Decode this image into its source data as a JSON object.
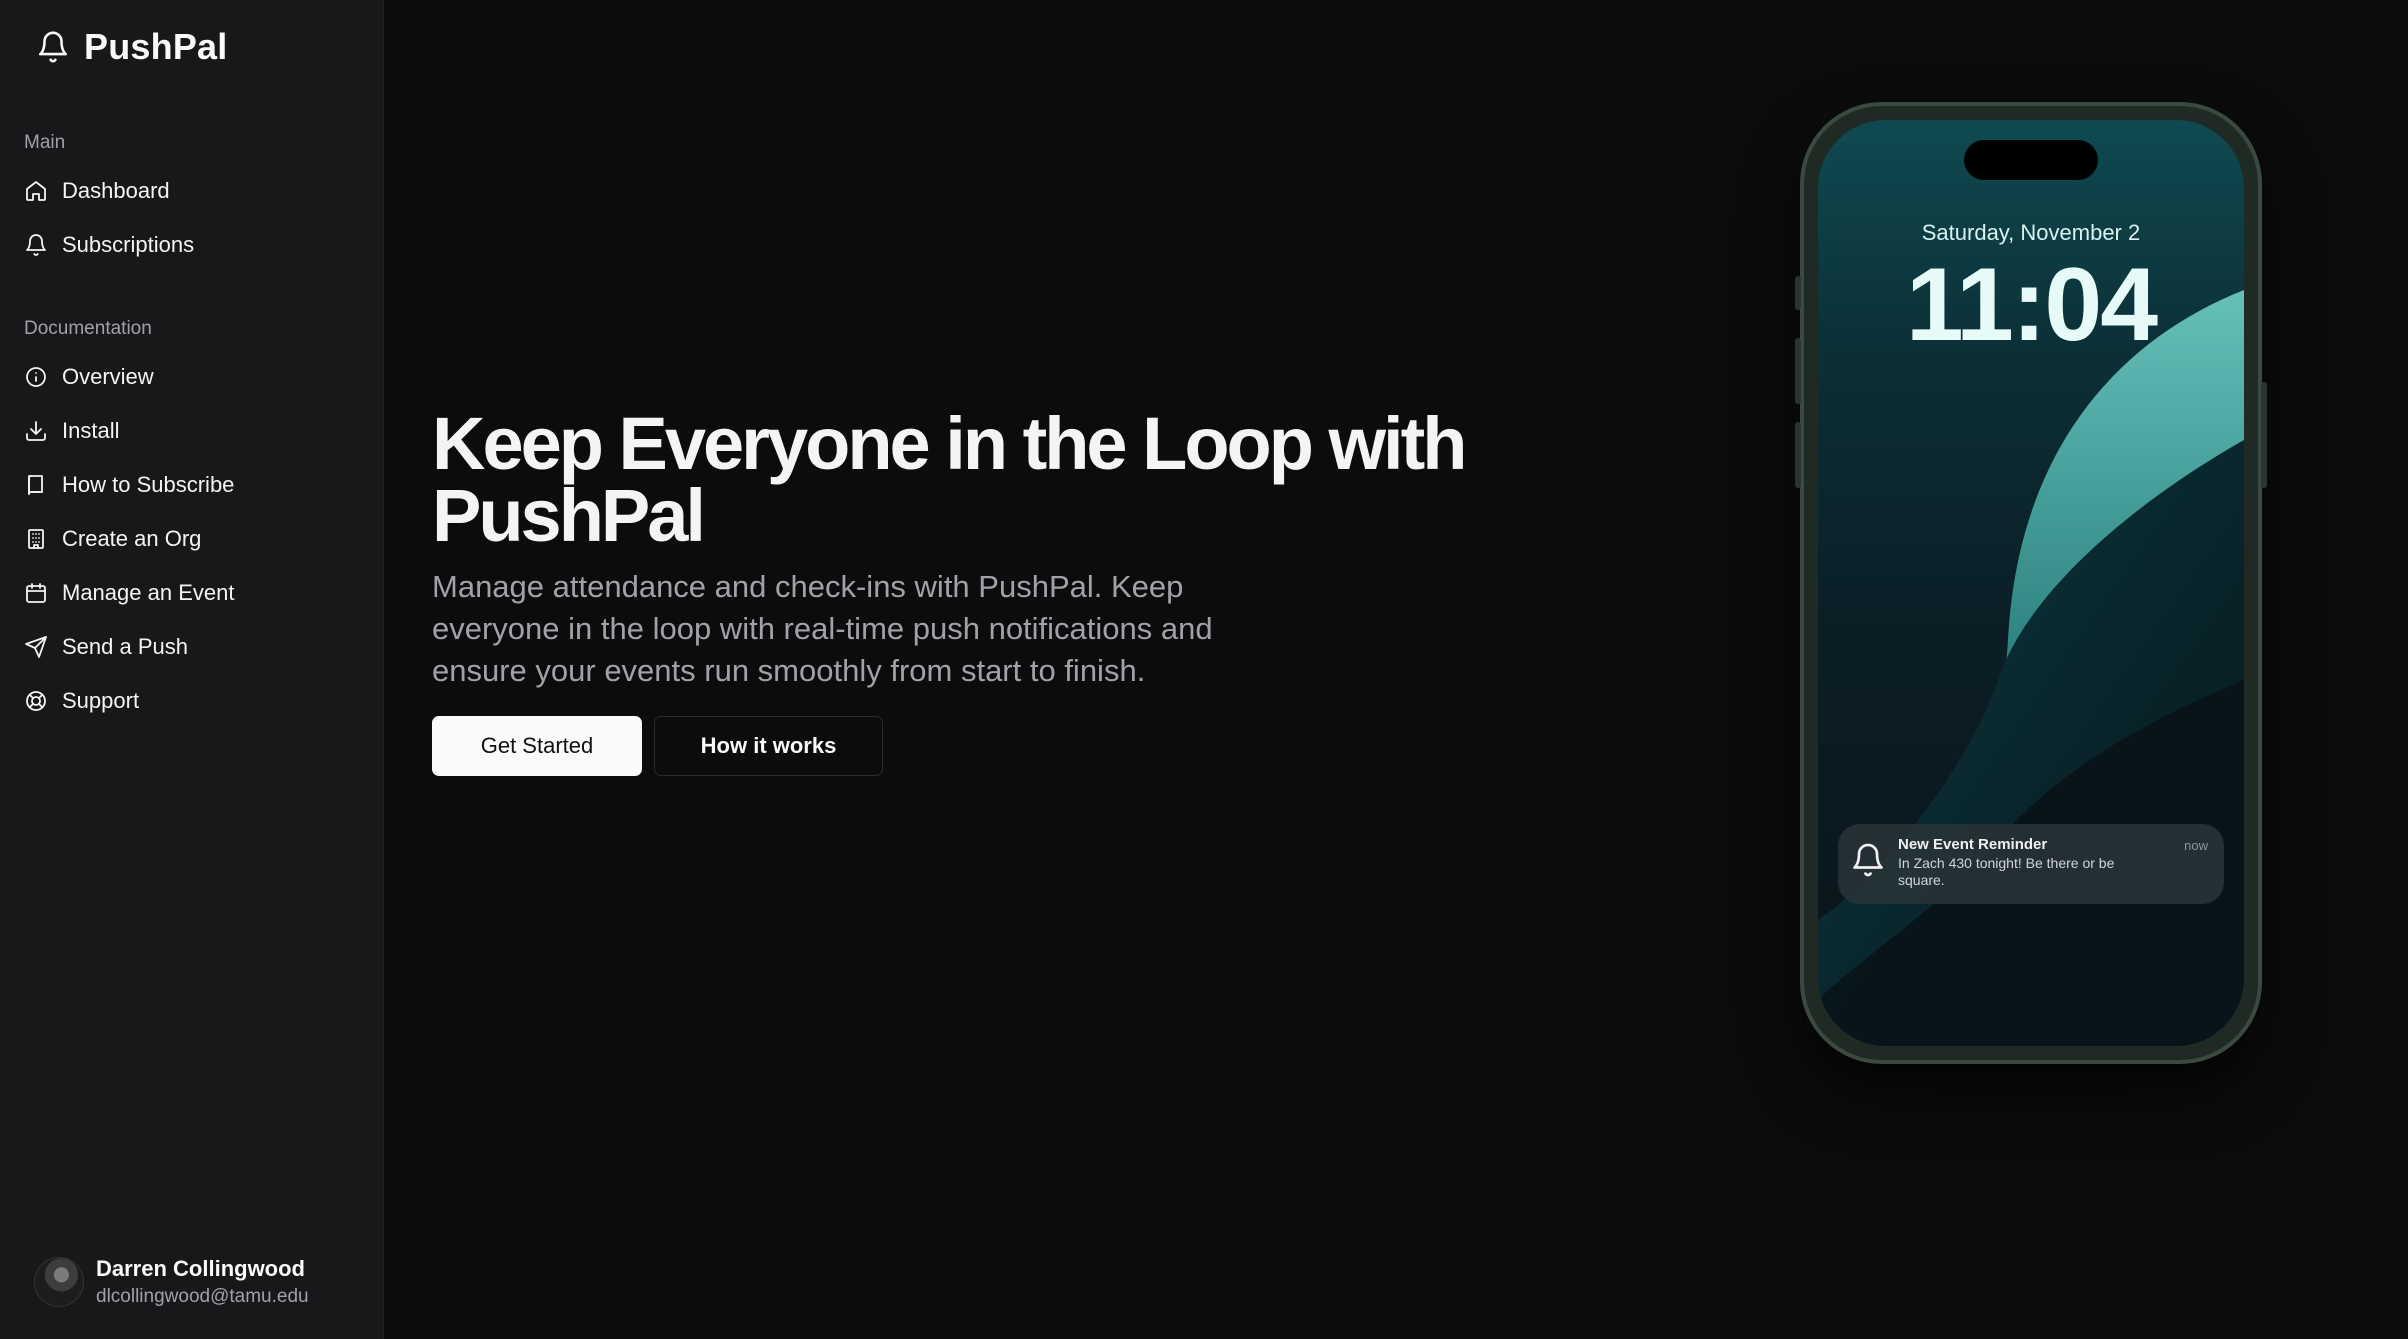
{
  "brand": {
    "name": "PushPal",
    "icon": "bell-icon"
  },
  "sidebar": {
    "groups": [
      {
        "label": "Main"
      },
      {
        "label": "Documentation"
      }
    ],
    "main_items": [
      {
        "label": "Dashboard",
        "icon": "home-icon"
      },
      {
        "label": "Subscriptions",
        "icon": "bell-icon"
      }
    ],
    "doc_items": [
      {
        "label": "Overview",
        "icon": "info-icon"
      },
      {
        "label": "Install",
        "icon": "download-icon"
      },
      {
        "label": "How to Subscribe",
        "icon": "book-icon"
      },
      {
        "label": "Create an Org",
        "icon": "building-icon"
      },
      {
        "label": "Manage an Event",
        "icon": "calendar-icon"
      },
      {
        "label": "Send a Push",
        "icon": "send-icon"
      },
      {
        "label": "Support",
        "icon": "lifebuoy-icon"
      }
    ],
    "user": {
      "name": "Darren Collingwood",
      "email": "dlcollingwood@tamu.edu"
    }
  },
  "hero": {
    "title": "Keep Everyone in the Loop with PushPal",
    "subtitle": "Manage attendance and check-ins with PushPal. Keep everyone in the loop with real-time push notifications and ensure your events run smoothly from start to finish.",
    "primary_button": "Get Started",
    "secondary_button": "How it works"
  },
  "phone": {
    "date": "Saturday, November 2",
    "time": "11:04",
    "notification": {
      "title": "New Event Reminder",
      "text": "In Zach 430 tonight! Be there or be square.",
      "time": "now"
    }
  },
  "colors": {
    "background": "#0c0c0c",
    "sidebar": "#18181a",
    "accent_teal": "#4fb3ad"
  }
}
